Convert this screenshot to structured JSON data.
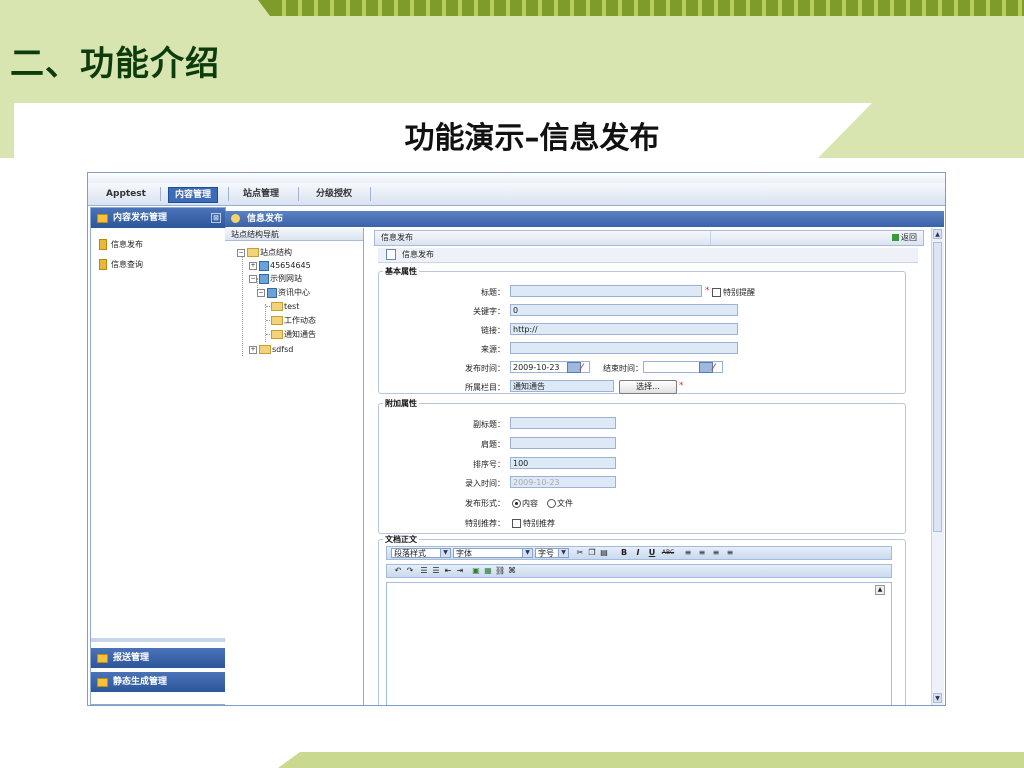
{
  "slide": {
    "title": "二、功能介绍",
    "subtitle": "功能演示–信息发布"
  },
  "app": {
    "nav_tabs": [
      {
        "label": "Apptest"
      },
      {
        "label": "内容管理",
        "active": true
      },
      {
        "label": "站点管理"
      },
      {
        "label": "分级授权"
      }
    ],
    "sidebar": {
      "header": "内容发布管理",
      "items": [
        "信息发布",
        "信息查询"
      ],
      "footer_sections": [
        "报送管理",
        "静态生成管理"
      ]
    },
    "tab_title": "信息发布",
    "tree": {
      "header": "站点结构导航",
      "nodes": [
        "站点结构",
        "45654645",
        "示例网站",
        "资讯中心",
        "test",
        "工作动态",
        "通知通告",
        "sdfsd"
      ]
    },
    "main": {
      "header_title": "信息发布",
      "back_label": "返回",
      "form_title": "信息发布",
      "basic": {
        "legend": "基本属性",
        "title_label": "标题：",
        "title_value": "",
        "special_remind": "特别提醒",
        "keywords_label": "关键字：",
        "keywords_value": "0",
        "link_label": "链接：",
        "link_value": "http://",
        "source_label": "来源：",
        "source_value": "",
        "publish_time_label": "发布时间：",
        "publish_time_value": "2009-10-23",
        "end_time_label": "结束时间：",
        "end_time_value": "",
        "column_label": "所属栏目：",
        "column_value": "通知通告",
        "choose_button": "选择..."
      },
      "extra": {
        "legend": "附加属性",
        "subtitle_label": "副标题：",
        "subtitle_value": "",
        "pretitle_label": "肩题：",
        "pretitle_value": "",
        "order_label": "排序号：",
        "order_value": "100",
        "entry_time_label": "录入时间：",
        "entry_time_value": "2009-10-23",
        "publish_form_label": "发布形式：",
        "publish_form_options": [
          "内容",
          "文件"
        ],
        "publish_form_selected": "内容",
        "recommend_label": "特别推荐：",
        "recommend_option": "特别推荐"
      },
      "body": {
        "legend": "文档正文",
        "paragraph_style": "段落样式",
        "font": "字体",
        "font_size": "字号",
        "format_buttons": [
          "B",
          "I",
          "U",
          "ABC"
        ]
      }
    },
    "colors": {
      "nav_active": "#3d6bb5",
      "header_blue": "#2d559a",
      "input_bg": "#dde9f6",
      "required": "#e0352a",
      "slide_green": "#d9e5b0",
      "title_green": "#0c3c0c"
    }
  }
}
